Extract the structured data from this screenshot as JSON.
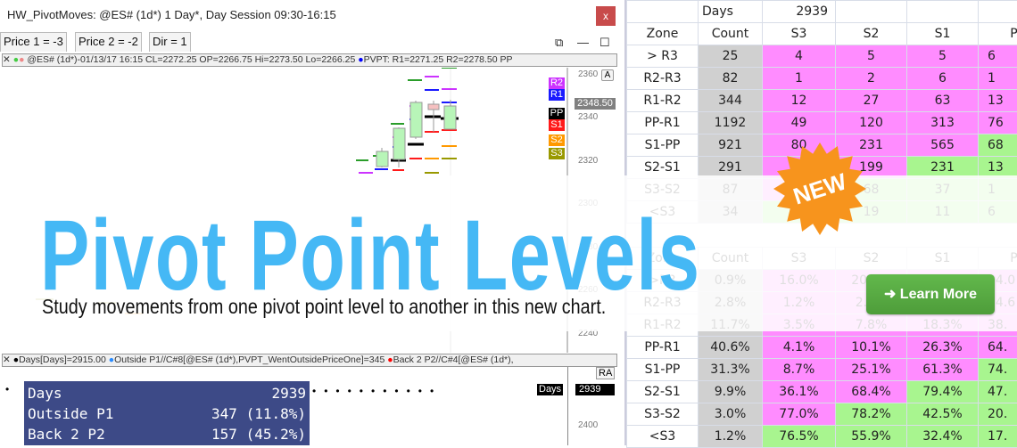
{
  "window": {
    "title": "HW_PivotMoves: @ES# (1d*) 1 Day*, Day Session 09:30-16:15",
    "close": "x",
    "tabs": [
      "Price 1 = -3",
      "Price 2 = -2",
      "Dir = 1"
    ],
    "controls": {
      "restore": "⧉",
      "minimize": "—",
      "maximize": "☐"
    }
  },
  "chart": {
    "legend": "@ES# (1d*)-01/13/17 16:15 CL=2272.25 OP=2266.75 Hi=2273.50 Lo=2266.25",
    "legend_pivot": "PVPT: R1=2271.25 R2=2278.50 PP",
    "y_ticks": [
      "2360",
      "2340",
      "2320",
      "2300",
      "2280",
      "2260",
      "2240"
    ],
    "auto_button": "A",
    "levels": [
      {
        "label": "R2",
        "color": "#cc33ff"
      },
      {
        "label": "R1",
        "color": "#1a1aff"
      },
      {
        "label": "PP",
        "color": "#000000"
      },
      {
        "label": "S1",
        "color": "#ff1a1a"
      },
      {
        "label": "S2",
        "color": "#ff9900"
      },
      {
        "label": "S3",
        "color": "#999900"
      }
    ],
    "last_price": "2348.50"
  },
  "indicator": {
    "legend": [
      "Days[Days]=2915.00",
      "Outside P1//C#8[@ES# (1d*),PVPT_WentOutsidePriceOne]=345",
      "Back 2 P2//C#4[@ES# (1d*),"
    ],
    "ra_button": "RA",
    "stats": [
      {
        "label": "Days",
        "value": "2939"
      },
      {
        "label": "Outside P1",
        "value": "347 (11.8%)"
      },
      {
        "label": "Back 2 P2",
        "value": "157 (45.2%)"
      }
    ],
    "days_label": "Days",
    "days_value": "2939",
    "y_tick": "2400"
  },
  "table_counts": {
    "days_label": "Days",
    "days_value": "2939",
    "headers": [
      "Zone",
      "Count",
      "S3",
      "S2",
      "S1",
      "P"
    ],
    "rows": [
      {
        "zone": "> R3",
        "count": "25",
        "cells": [
          "4",
          "5",
          "5",
          "6"
        ]
      },
      {
        "zone": "R2-R3",
        "count": "82",
        "cells": [
          "1",
          "2",
          "6",
          "1"
        ]
      },
      {
        "zone": "R1-R2",
        "count": "344",
        "cells": [
          "12",
          "27",
          "63",
          "13"
        ]
      },
      {
        "zone": "PP-R1",
        "count": "1192",
        "cells": [
          "49",
          "120",
          "313",
          "76"
        ]
      },
      {
        "zone": "S1-PP",
        "count": "921",
        "cells": [
          "80",
          "231",
          "565",
          "68"
        ]
      },
      {
        "zone": "S2-S1",
        "count": "291",
        "cells": [
          "",
          "199",
          "231",
          "13"
        ]
      },
      {
        "zone": "S3-S2",
        "count": "87",
        "cells": [
          "",
          "68",
          "37",
          "1"
        ]
      },
      {
        "zone": "<S3",
        "count": "34",
        "cells": [
          "",
          "19",
          "11",
          "6"
        ]
      }
    ]
  },
  "table_pct": {
    "headers": [
      "Zone",
      "Count",
      "S3",
      "S2",
      "S1",
      "P"
    ],
    "rows": [
      {
        "zone": ">R3",
        "count": "0.9%",
        "cells": [
          "16.0%",
          "20.0%",
          "20.0%",
          "24.0"
        ]
      },
      {
        "zone": "R2-R3",
        "count": "2.8%",
        "cells": [
          "1.2%",
          "2.4%",
          "7.3%",
          "14.6"
        ]
      },
      {
        "zone": "R1-R2",
        "count": "11.7%",
        "cells": [
          "3.5%",
          "7.8%",
          "18.3%",
          "38."
        ]
      },
      {
        "zone": "PP-R1",
        "count": "40.6%",
        "cells": [
          "4.1%",
          "10.1%",
          "26.3%",
          "64."
        ]
      },
      {
        "zone": "S1-PP",
        "count": "31.3%",
        "cells": [
          "8.7%",
          "25.1%",
          "61.3%",
          "74."
        ]
      },
      {
        "zone": "S2-S1",
        "count": "9.9%",
        "cells": [
          "36.1%",
          "68.4%",
          "79.4%",
          "47."
        ]
      },
      {
        "zone": "S3-S2",
        "count": "3.0%",
        "cells": [
          "77.0%",
          "78.2%",
          "42.5%",
          "20."
        ]
      },
      {
        "zone": "<S3",
        "count": "1.2%",
        "cells": [
          "76.5%",
          "55.9%",
          "32.4%",
          "17."
        ]
      }
    ]
  },
  "colors": {
    "pink": "#ff8cff",
    "green": "#a8f58f",
    "gray": "#d0d0d0",
    "headline": "#45b8f5",
    "badge": "#f7941d",
    "button": "#5aad44"
  },
  "promo": {
    "headline": "Pivot Point Levels",
    "subtitle": "Study movements from one pivot point level to another in this new chart.",
    "badge": "NEW",
    "button": "➜ Learn More"
  }
}
